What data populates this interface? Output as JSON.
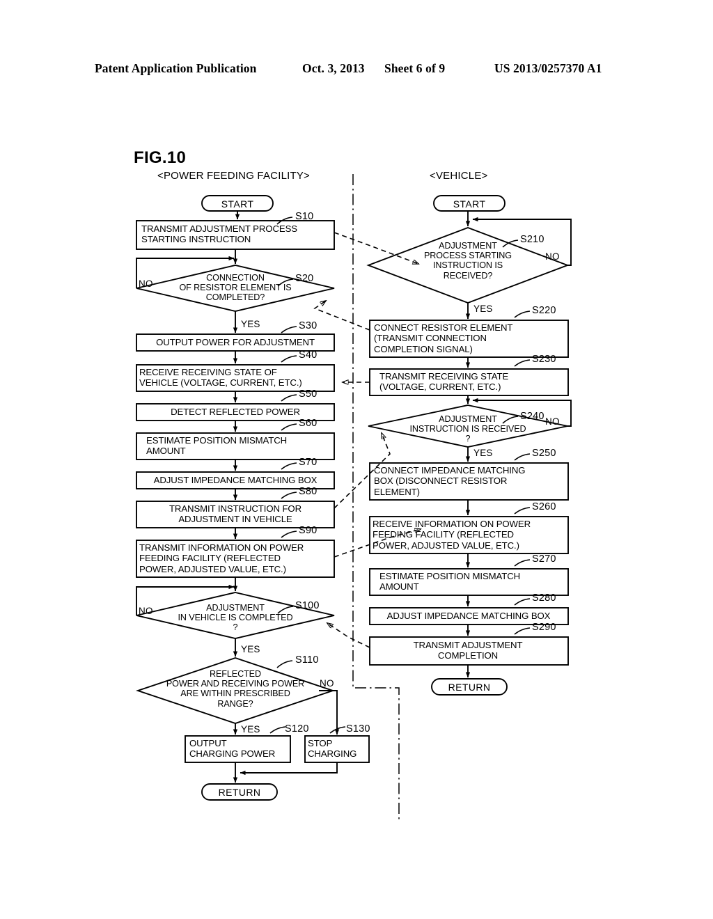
{
  "header": {
    "publication": "Patent Application Publication",
    "date": "Oct. 3, 2013",
    "sheet": "Sheet 6 of 9",
    "number": "US 2013/0257370 A1"
  },
  "figure": {
    "label": "FIG.10",
    "left_column_caption": "<POWER FEEDING FACILITY>",
    "right_column_caption": "<VEHICLE>"
  },
  "left_flow": {
    "start": "START",
    "return": "RETURN",
    "nodes": [
      {
        "id": "S10",
        "type": "process",
        "text": "TRANSMIT ADJUSTMENT PROCESS\nSTARTING INSTRUCTION"
      },
      {
        "id": "S20",
        "type": "decision",
        "text": "CONNECTION\nOF RESISTOR ELEMENT IS\nCOMPLETED?",
        "no": "NO",
        "yes": "YES"
      },
      {
        "id": "S30",
        "type": "process",
        "text": "OUTPUT POWER FOR ADJUSTMENT"
      },
      {
        "id": "S40",
        "type": "process",
        "text": "RECEIVE RECEIVING STATE OF\nVEHICLE (VOLTAGE, CURRENT, ETC.)"
      },
      {
        "id": "S50",
        "type": "process",
        "text": "DETECT REFLECTED POWER"
      },
      {
        "id": "S60",
        "type": "process",
        "text": "ESTIMATE POSITION MISMATCH\nAMOUNT"
      },
      {
        "id": "S70",
        "type": "process",
        "text": "ADJUST IMPEDANCE MATCHING BOX"
      },
      {
        "id": "S80",
        "type": "process",
        "text": "TRANSMIT INSTRUCTION FOR\nADJUSTMENT IN VEHICLE"
      },
      {
        "id": "S90",
        "type": "process",
        "text": "TRANSMIT INFORMATION ON POWER\nFEEDING FACILITY (REFLECTED\nPOWER, ADJUSTED VALUE, ETC.)"
      },
      {
        "id": "S100",
        "type": "decision",
        "text": "ADJUSTMENT\nIN VEHICLE IS COMPLETED\n?",
        "no": "NO",
        "yes": "YES"
      },
      {
        "id": "S110",
        "type": "decision",
        "text": "REFLECTED\nPOWER AND RECEIVING POWER\nARE WITHIN PRESCRIBED\nRANGE?",
        "no": "NO",
        "yes": "YES"
      },
      {
        "id": "S120",
        "type": "process",
        "text": "OUTPUT\nCHARGING POWER"
      },
      {
        "id": "S130",
        "type": "process",
        "text": "STOP\nCHARGING"
      }
    ]
  },
  "right_flow": {
    "start": "START",
    "return": "RETURN",
    "nodes": [
      {
        "id": "S210",
        "type": "decision",
        "text": "ADJUSTMENT\nPROCESS STARTING\nINSTRUCTION IS\nRECEIVED?",
        "no": "NO",
        "yes": "YES"
      },
      {
        "id": "S220",
        "type": "process",
        "text": "CONNECT RESISTOR ELEMENT\n(TRANSMIT CONNECTION\nCOMPLETION SIGNAL)"
      },
      {
        "id": "S230",
        "type": "process",
        "text": "TRANSMIT RECEIVING STATE\n(VOLTAGE, CURRENT, ETC.)"
      },
      {
        "id": "S240",
        "type": "decision",
        "text": "ADJUSTMENT\nINSTRUCTION IS RECEIVED\n?",
        "no": "NO",
        "yes": "YES"
      },
      {
        "id": "S250",
        "type": "process",
        "text": "CONNECT IMPEDANCE MATCHING\nBOX (DISCONNECT RESISTOR\nELEMENT)"
      },
      {
        "id": "S260",
        "type": "process",
        "text": "RECEIVE INFORMATION ON POWER\nFEEDING FACILITY (REFLECTED\nPOWER, ADJUSTED VALUE, ETC.)"
      },
      {
        "id": "S270",
        "type": "process",
        "text": "ESTIMATE POSITION MISMATCH\nAMOUNT"
      },
      {
        "id": "S280",
        "type": "process",
        "text": "ADJUST IMPEDANCE MATCHING BOX"
      },
      {
        "id": "S290",
        "type": "process",
        "text": "TRANSMIT ADJUSTMENT\nCOMPLETION"
      }
    ]
  },
  "colors": {
    "ink": "#000000",
    "paper": "#ffffff"
  }
}
